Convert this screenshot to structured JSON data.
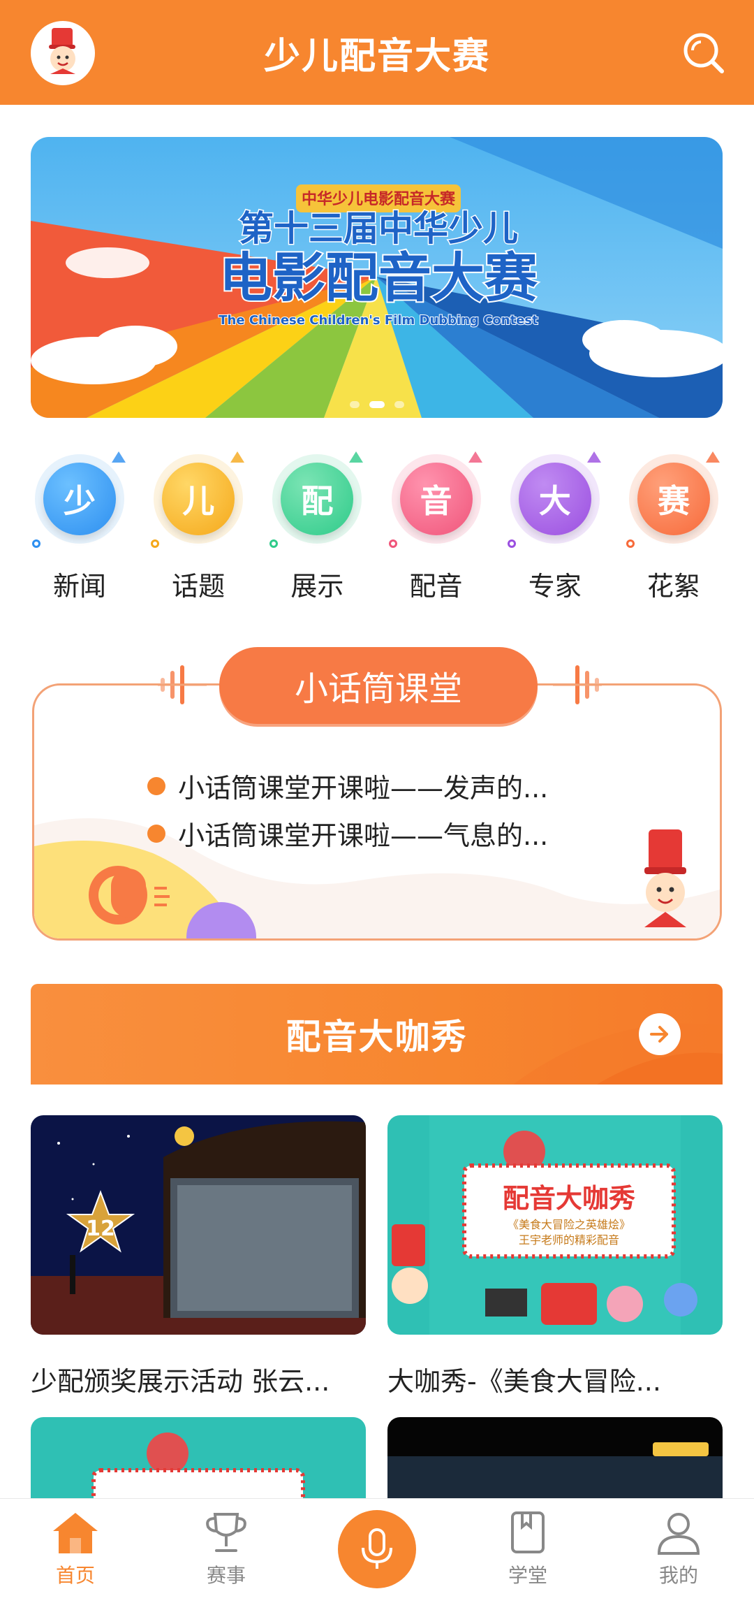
{
  "header": {
    "title": "少儿配音大赛",
    "avatar_icon": "mascot-icon",
    "search_icon": "search-icon"
  },
  "banner": {
    "logo_text": "中华少儿电影配音大赛",
    "headline_top": "第十三届中华少儿",
    "headline_main": "电影配音大赛",
    "subtitle_en": "The Chinese Children's Film Dubbing Contest",
    "slides": 3,
    "active_slide": 2
  },
  "categories": [
    {
      "glyph": "少",
      "label": "新闻",
      "color": "#2D8FF0"
    },
    {
      "glyph": "儿",
      "label": "话题",
      "color": "#F5A81A"
    },
    {
      "glyph": "配",
      "label": "展示",
      "color": "#2FCB8A"
    },
    {
      "glyph": "音",
      "label": "配音",
      "color": "#F0557A"
    },
    {
      "glyph": "大",
      "label": "专家",
      "color": "#9B4FE0"
    },
    {
      "glyph": "赛",
      "label": "花絮",
      "color": "#F76A3A"
    }
  ],
  "classroom": {
    "title": "小话筒课堂",
    "items": [
      "小话筒课堂开课啦——发声的...",
      "小话筒课堂开课啦——气息的..."
    ]
  },
  "showcase": {
    "title": "配音大咖秀",
    "arrow_icon": "arrow-right-icon"
  },
  "videos": [
    {
      "title": "少配颁奖展示活动 张云...",
      "badge": "12"
    },
    {
      "title": "大咖秀-《美食大冒险...",
      "poster_title": "配音大咖秀",
      "poster_sub1": "《美食大冒险之英雄烩》",
      "poster_sub2": "王宇老师的精彩配音"
    }
  ],
  "nav": [
    {
      "label": "首页",
      "icon": "home-icon",
      "active": true
    },
    {
      "label": "赛事",
      "icon": "trophy-icon",
      "active": false
    },
    {
      "label": "",
      "icon": "microphone-icon",
      "active": false
    },
    {
      "label": "学堂",
      "icon": "book-icon",
      "active": false
    },
    {
      "label": "我的",
      "icon": "user-icon",
      "active": false
    }
  ],
  "colors": {
    "brand": "#F7862F",
    "accent": "#F77A45"
  }
}
